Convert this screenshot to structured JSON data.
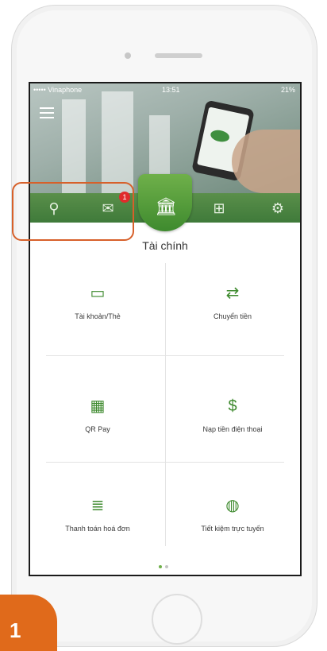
{
  "status_bar": {
    "carrier": "••••• Vinaphone",
    "time": "13:51",
    "battery": "21%"
  },
  "header": {
    "section_title": "Tài chính",
    "notification_count": "1"
  },
  "nav": {
    "items": [
      {
        "icon": "search-icon",
        "glyph": "⚲"
      },
      {
        "icon": "mail-icon",
        "glyph": "✉"
      },
      {
        "icon": "bank-icon",
        "glyph": "🏛"
      },
      {
        "icon": "grid-icon",
        "glyph": "⊞"
      },
      {
        "icon": "gear-icon",
        "glyph": "⚙"
      }
    ]
  },
  "tiles": [
    {
      "label": "Tài khoản/Thẻ",
      "icon": "wallet-icon",
      "glyph": "▭"
    },
    {
      "label": "Chuyển tiền",
      "icon": "transfer-icon",
      "glyph": "⇄"
    },
    {
      "label": "QR Pay",
      "icon": "qr-icon",
      "glyph": "▦"
    },
    {
      "label": "Nạp tiền điện thoại",
      "icon": "phone-topup-icon",
      "glyph": "$"
    },
    {
      "label": "Thanh toán hoá đơn",
      "icon": "bill-icon",
      "glyph": "≣"
    },
    {
      "label": "Tiết kiệm trực tuyến",
      "icon": "piggy-bank-icon",
      "glyph": "◍"
    }
  ],
  "pager": {
    "active_page": 1,
    "total_pages": 2
  },
  "step": {
    "number": "1"
  },
  "colors": {
    "brand_green": "#3e8a2e",
    "highlight": "#d7602a",
    "step_badge": "#e06a1b"
  }
}
